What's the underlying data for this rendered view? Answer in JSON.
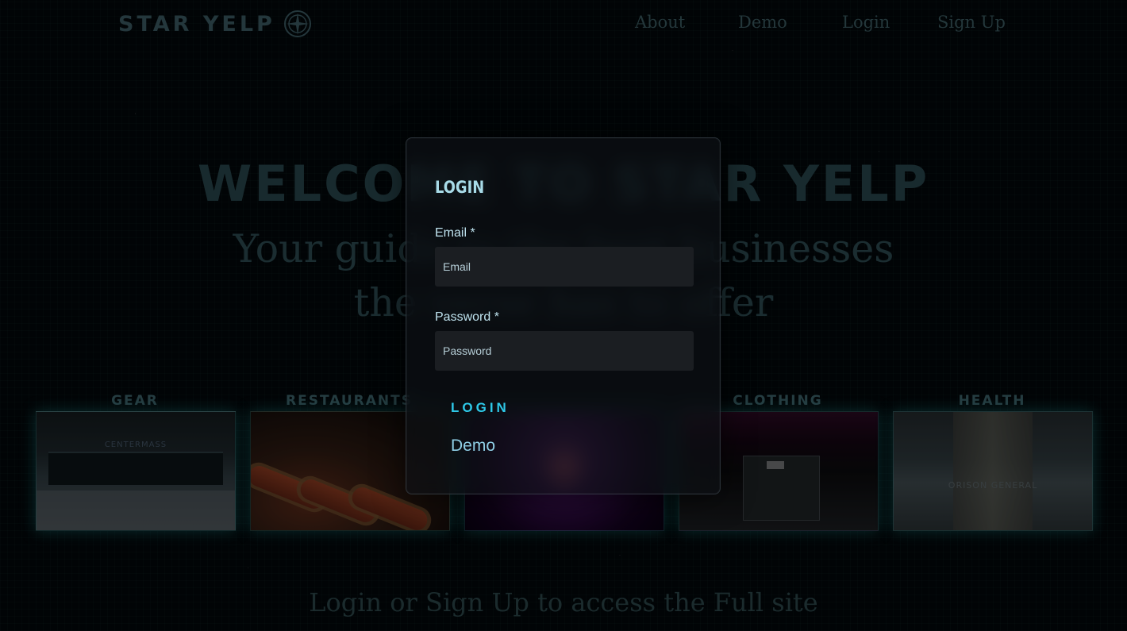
{
  "header": {
    "logo_text": "STAR YELP",
    "nav": [
      {
        "label": "About"
      },
      {
        "label": "Demo"
      },
      {
        "label": "Login"
      },
      {
        "label": "Sign Up"
      }
    ]
  },
  "hero": {
    "title": "WELCOME TO STAR YELP",
    "subtitle": "Your guide to the best businesses the verse has to offer"
  },
  "categories": [
    {
      "label": "GEAR",
      "sign": "CENTERMASS"
    },
    {
      "label": "RESTAURANTS"
    },
    {
      "label": ""
    },
    {
      "label": "CLOTHING"
    },
    {
      "label": "HEALTH",
      "sign": "ORISON GENERAL"
    }
  ],
  "footer": {
    "text": "Login or Sign Up to access the Full site"
  },
  "modal": {
    "title": "LOGIN",
    "email_label": "Email *",
    "email_placeholder": "Email",
    "password_label": "Password *",
    "password_placeholder": "Password",
    "login_button": "LOGIN",
    "demo_button": "Demo"
  },
  "colors": {
    "accent": "#2ec9e8",
    "modal_text": "#bfe3ef",
    "background": "#03070a"
  }
}
